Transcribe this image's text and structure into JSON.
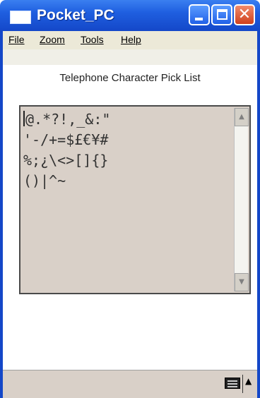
{
  "window": {
    "title": "Pocket_PC",
    "close_glyph": "✕"
  },
  "menu": {
    "items": [
      {
        "label": "File"
      },
      {
        "label": "Zoom"
      },
      {
        "label": "Tools"
      },
      {
        "label": "Help"
      }
    ]
  },
  "content": {
    "heading": "Telephone Character Pick List",
    "picklist_lines": [
      "@.*?!,_&:\"",
      "'-/+=$£€¥#",
      "%;¿\\<>[]{}",
      "()|^~"
    ]
  },
  "scrollbar": {
    "up_glyph": "▲",
    "down_glyph": "▼"
  },
  "bottombar": {
    "input_arrow_glyph": "▲",
    "icon": "keyboard-icon"
  },
  "colors": {
    "titlebar": "#1f5fe0",
    "close_button": "#d0401c",
    "picklist_background": "#d9d0c8",
    "menubar_background": "#ece9d8"
  }
}
